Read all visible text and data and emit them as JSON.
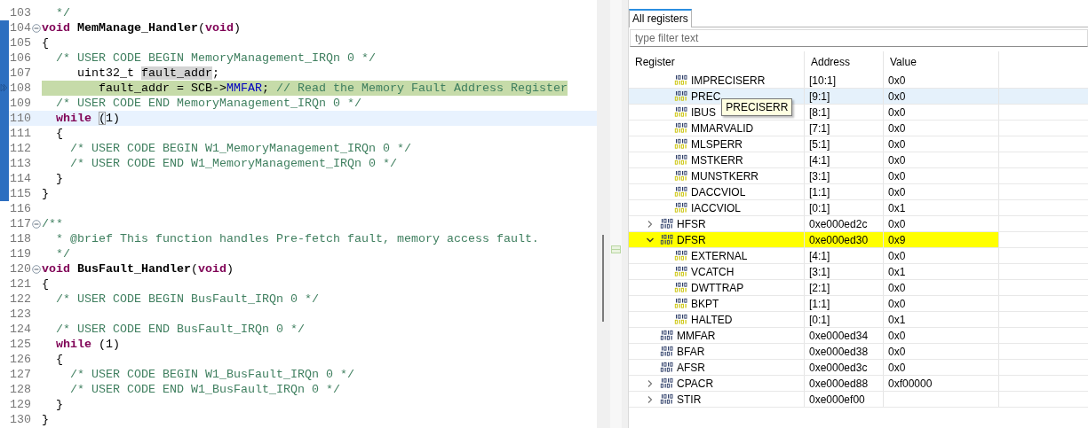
{
  "editor": {
    "lines": [
      {
        "number": "103",
        "changed": false,
        "foldable": false,
        "current_instruction": false,
        "cursor_line": false,
        "segments": [
          {
            "kind": "comment",
            "text": "  */"
          }
        ]
      },
      {
        "number": "104",
        "changed": true,
        "foldable": true,
        "current_instruction": false,
        "cursor_line": false,
        "segments": [
          {
            "kind": "keyword",
            "text": "void"
          },
          {
            "kind": "function",
            "text": " MemManage_Handler"
          },
          {
            "kind": "plain",
            "text": "("
          },
          {
            "kind": "keyword",
            "text": "void"
          },
          {
            "kind": "plain",
            "text": ")"
          }
        ]
      },
      {
        "number": "105",
        "changed": true,
        "foldable": false,
        "current_instruction": false,
        "cursor_line": false,
        "segments": [
          {
            "kind": "plain",
            "text": "{"
          }
        ]
      },
      {
        "number": "106",
        "changed": true,
        "foldable": false,
        "current_instruction": false,
        "cursor_line": false,
        "segments": [
          {
            "kind": "comment",
            "text": "  /* USER CODE BEGIN MemoryManagement_IRQn 0 */"
          }
        ]
      },
      {
        "number": "107",
        "changed": true,
        "foldable": false,
        "current_instruction": false,
        "cursor_line": false,
        "segments": [
          {
            "kind": "plain",
            "text": "     uint32_t "
          },
          {
            "kind": "occurrence",
            "text": "fault_addr"
          },
          {
            "kind": "plain",
            "text": ";"
          }
        ]
      },
      {
        "number": "108",
        "changed": true,
        "foldable": false,
        "current_instruction": true,
        "cursor_line": false,
        "segments": [
          {
            "kind": "plain",
            "text": "        fault_addr = SCB->"
          },
          {
            "kind": "field",
            "text": "MMFAR"
          },
          {
            "kind": "plain",
            "text": "; "
          },
          {
            "kind": "comment",
            "text": "// Read the Memory Fault Address Register"
          }
        ]
      },
      {
        "number": "109",
        "changed": true,
        "foldable": false,
        "current_instruction": false,
        "cursor_line": false,
        "segments": [
          {
            "kind": "comment",
            "text": "  /* USER CODE END MemoryManagement_IRQn 0 */"
          }
        ]
      },
      {
        "number": "110",
        "changed": true,
        "foldable": false,
        "current_instruction": false,
        "cursor_line": true,
        "segments": [
          {
            "kind": "keyword",
            "text": "  while "
          },
          {
            "kind": "bracket",
            "text": "("
          },
          {
            "kind": "plain",
            "text": "1)"
          }
        ]
      },
      {
        "number": "111",
        "changed": true,
        "foldable": false,
        "current_instruction": false,
        "cursor_line": false,
        "segments": [
          {
            "kind": "plain",
            "text": "  {"
          }
        ]
      },
      {
        "number": "112",
        "changed": true,
        "foldable": false,
        "current_instruction": false,
        "cursor_line": false,
        "segments": [
          {
            "kind": "comment",
            "text": "    /* USER CODE BEGIN W1_MemoryManagement_IRQn 0 */"
          }
        ]
      },
      {
        "number": "113",
        "changed": true,
        "foldable": false,
        "current_instruction": false,
        "cursor_line": false,
        "segments": [
          {
            "kind": "comment",
            "text": "    /* USER CODE END W1_MemoryManagement_IRQn 0 */"
          }
        ]
      },
      {
        "number": "114",
        "changed": true,
        "foldable": false,
        "current_instruction": false,
        "cursor_line": false,
        "segments": [
          {
            "kind": "plain",
            "text": "  }"
          }
        ]
      },
      {
        "number": "115",
        "changed": true,
        "foldable": false,
        "current_instruction": false,
        "cursor_line": false,
        "segments": [
          {
            "kind": "plain",
            "text": "}"
          }
        ]
      },
      {
        "number": "116",
        "changed": false,
        "foldable": false,
        "current_instruction": false,
        "cursor_line": false
      },
      {
        "number": "117",
        "changed": false,
        "foldable": true,
        "current_instruction": false,
        "cursor_line": false,
        "segments": [
          {
            "kind": "comment",
            "text": "/**"
          }
        ]
      },
      {
        "number": "118",
        "changed": false,
        "foldable": false,
        "current_instruction": false,
        "cursor_line": false,
        "segments": [
          {
            "kind": "comment",
            "text": "  * @brief This function handles Pre-fetch fault, memory access fault."
          }
        ]
      },
      {
        "number": "119",
        "changed": false,
        "foldable": false,
        "current_instruction": false,
        "cursor_line": false,
        "segments": [
          {
            "kind": "comment",
            "text": "  */"
          }
        ]
      },
      {
        "number": "120",
        "changed": false,
        "foldable": true,
        "current_instruction": false,
        "cursor_line": false,
        "segments": [
          {
            "kind": "keyword",
            "text": "void"
          },
          {
            "kind": "function",
            "text": " BusFault_Handler"
          },
          {
            "kind": "plain",
            "text": "("
          },
          {
            "kind": "keyword",
            "text": "void"
          },
          {
            "kind": "plain",
            "text": ")"
          }
        ]
      },
      {
        "number": "121",
        "changed": false,
        "foldable": false,
        "current_instruction": false,
        "cursor_line": false,
        "segments": [
          {
            "kind": "plain",
            "text": "{"
          }
        ]
      },
      {
        "number": "122",
        "changed": false,
        "foldable": false,
        "current_instruction": false,
        "cursor_line": false,
        "segments": [
          {
            "kind": "comment",
            "text": "  /* USER CODE BEGIN BusFault_IRQn 0 */"
          }
        ]
      },
      {
        "number": "123",
        "changed": false,
        "foldable": false,
        "current_instruction": false,
        "cursor_line": false
      },
      {
        "number": "124",
        "changed": false,
        "foldable": false,
        "current_instruction": false,
        "cursor_line": false,
        "segments": [
          {
            "kind": "comment",
            "text": "  /* USER CODE END BusFault_IRQn 0 */"
          }
        ]
      },
      {
        "number": "125",
        "changed": false,
        "foldable": false,
        "current_instruction": false,
        "cursor_line": false,
        "segments": [
          {
            "kind": "keyword",
            "text": "  while"
          },
          {
            "kind": "plain",
            "text": " (1)"
          }
        ]
      },
      {
        "number": "126",
        "changed": false,
        "foldable": false,
        "current_instruction": false,
        "cursor_line": false,
        "segments": [
          {
            "kind": "plain",
            "text": "  {"
          }
        ]
      },
      {
        "number": "127",
        "changed": false,
        "foldable": false,
        "current_instruction": false,
        "cursor_line": false,
        "segments": [
          {
            "kind": "comment",
            "text": "    /* USER CODE BEGIN W1_BusFault_IRQn 0 */"
          }
        ]
      },
      {
        "number": "128",
        "changed": false,
        "foldable": false,
        "current_instruction": false,
        "cursor_line": false,
        "segments": [
          {
            "kind": "comment",
            "text": "    /* USER CODE END W1_BusFault_IRQn 0 */"
          }
        ]
      },
      {
        "number": "129",
        "changed": false,
        "foldable": false,
        "current_instruction": false,
        "cursor_line": false,
        "segments": [
          {
            "kind": "plain",
            "text": "  }"
          }
        ]
      },
      {
        "number": "130",
        "changed": false,
        "foldable": false,
        "current_instruction": false,
        "cursor_line": false,
        "segments": [
          {
            "kind": "plain",
            "text": "}"
          }
        ]
      }
    ]
  },
  "registers_view": {
    "tabs": [
      {
        "label": "All registers",
        "selected": true
      }
    ],
    "filter": {
      "placeholder": "type filter text"
    },
    "columns": [
      "Register",
      "Address",
      "Value"
    ],
    "rows": [
      {
        "kind": "field-group",
        "children": [
          {
            "kind": "field",
            "name": "IMPRECISERR",
            "address": "[10:1]",
            "value": "0x0",
            "changed": false,
            "hovered": false
          },
          {
            "kind": "field",
            "name": "PREC",
            "address": "[9:1]",
            "value": "0x0",
            "changed": false,
            "hovered": true,
            "tooltip": "PRECISERR"
          },
          {
            "kind": "field",
            "name": "IBUS",
            "address": "[8:1]",
            "value": "0x0",
            "changed": false,
            "hovered": false
          },
          {
            "kind": "field",
            "name": "MMARVALID",
            "address": "[7:1]",
            "value": "0x0",
            "changed": false,
            "hovered": false
          },
          {
            "kind": "field",
            "name": "MLSPERR",
            "address": "[5:1]",
            "value": "0x0",
            "changed": false,
            "hovered": false
          },
          {
            "kind": "field",
            "name": "MSTKERR",
            "address": "[4:1]",
            "value": "0x0",
            "changed": false,
            "hovered": false
          },
          {
            "kind": "field",
            "name": "MUNSTKERR",
            "address": "[3:1]",
            "value": "0x0",
            "changed": false,
            "hovered": false
          },
          {
            "kind": "field",
            "name": "DACCVIOL",
            "address": "[1:1]",
            "value": "0x0",
            "changed": false,
            "hovered": false
          },
          {
            "kind": "field",
            "name": "IACCVIOL",
            "address": "[0:1]",
            "value": "0x1",
            "changed": false,
            "hovered": false
          }
        ]
      },
      {
        "kind": "register",
        "name": "HFSR",
        "address": "0xe000ed2c",
        "value": "0x0",
        "changed": false,
        "hovered": false,
        "expanded": false
      },
      {
        "kind": "register",
        "name": "DFSR",
        "address": "0xe000ed30",
        "value": "0x9",
        "changed": true,
        "hovered": false,
        "expanded": true,
        "children": [
          {
            "kind": "field",
            "name": "EXTERNAL",
            "address": "[4:1]",
            "value": "0x0",
            "changed": false,
            "hovered": false
          },
          {
            "kind": "field",
            "name": "VCATCH",
            "address": "[3:1]",
            "value": "0x1",
            "changed": false,
            "hovered": false
          },
          {
            "kind": "field",
            "name": "DWTTRAP",
            "address": "[2:1]",
            "value": "0x0",
            "changed": false,
            "hovered": false
          },
          {
            "kind": "field",
            "name": "BKPT",
            "address": "[1:1]",
            "value": "0x0",
            "changed": false,
            "hovered": false
          },
          {
            "kind": "field",
            "name": "HALTED",
            "address": "[0:1]",
            "value": "0x1",
            "changed": false,
            "hovered": false
          }
        ]
      },
      {
        "kind": "register",
        "name": "MMFAR",
        "address": "0xe000ed34",
        "value": "0x0",
        "changed": false,
        "hovered": false
      },
      {
        "kind": "register",
        "name": "BFAR",
        "address": "0xe000ed38",
        "value": "0x0",
        "changed": false,
        "hovered": false
      },
      {
        "kind": "register",
        "name": "AFSR",
        "address": "0xe000ed3c",
        "value": "0x0",
        "changed": false,
        "hovered": false
      },
      {
        "kind": "register",
        "name": "CPACR",
        "address": "0xe000ed88",
        "value": "0xf00000",
        "changed": false,
        "hovered": false,
        "expanded": false
      },
      {
        "kind": "register",
        "name": "STIR",
        "address": "0xe000ef00",
        "changed": false,
        "hovered": false,
        "expanded": false
      }
    ]
  }
}
